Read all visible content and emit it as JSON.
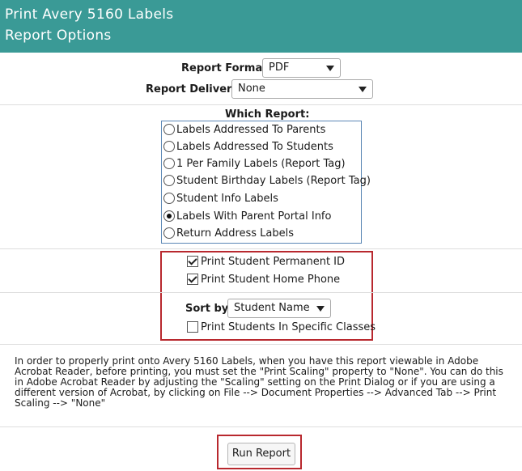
{
  "header": {
    "title_line1": "Print Avery 5160 Labels",
    "title_line2": "Report Options"
  },
  "report_format": {
    "label": "Report Format:",
    "value": "PDF"
  },
  "report_delivery": {
    "label": "Report Delivery:",
    "value": "None"
  },
  "which_report": {
    "title": "Which Report:",
    "options": [
      {
        "label": "Labels Addressed To Parents",
        "checked": false
      },
      {
        "label": "Labels Addressed To Students",
        "checked": false
      },
      {
        "label": "1 Per Family Labels (Report Tag)",
        "checked": false
      },
      {
        "label": "Student Birthday Labels (Report Tag)",
        "checked": false
      },
      {
        "label": "Student Info Labels",
        "checked": false
      },
      {
        "label": "Labels With Parent Portal Info",
        "checked": true
      },
      {
        "label": "Return Address Labels",
        "checked": false
      }
    ]
  },
  "options": {
    "print_permanent_id": {
      "label": "Print Student Permanent ID",
      "checked": true
    },
    "print_home_phone": {
      "label": "Print Student Home Phone",
      "checked": true
    },
    "sort_by": {
      "label": "Sort by:",
      "value": "Student Name"
    },
    "print_specific_classes": {
      "label": "Print Students In Specific Classes",
      "checked": false
    }
  },
  "note": "In order to properly print onto Avery 5160 Labels, when you have this report viewable in Adobe Acrobat Reader, before printing, you must set the \"Print Scaling\" property to \"None\". You can do this in Adobe Acrobat Reader by adjusting the \"Scaling\" setting on the Print Dialog or if you are using a different version of Acrobat, by clicking on File --> Document Properties --> Advanced Tab --> Print Scaling --> \"None\"",
  "run_button": {
    "label": "Run Report"
  },
  "colors": {
    "header_bg": "#3a9a96",
    "highlight_border": "#b8282e",
    "list_border": "#5b87b5"
  }
}
